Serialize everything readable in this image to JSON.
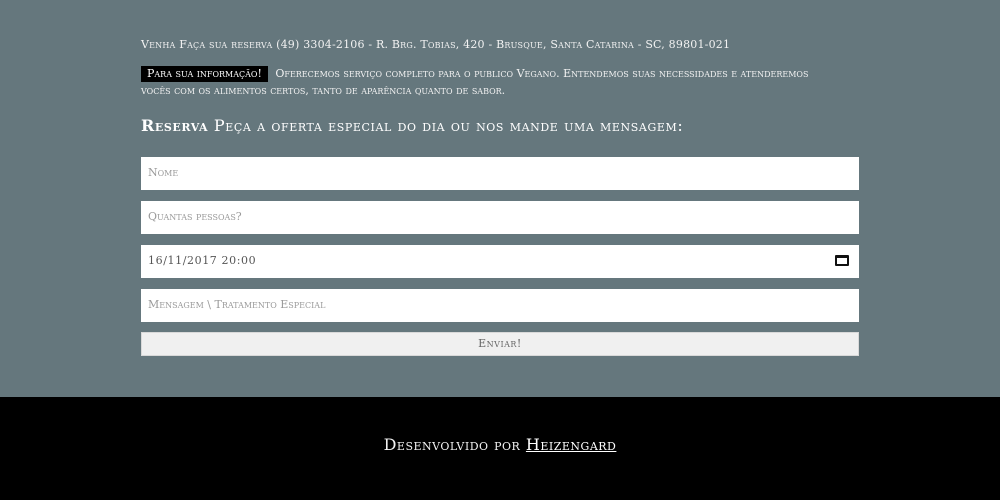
{
  "contact": {
    "text": "Venha Faça sua reserva (49) 3304-2106 - R. Brg. Tobias, 420 - Brusque, Santa Catarina - SC, 89801-021"
  },
  "info": {
    "tag": "Para sua informação!",
    "text": "Oferecemos serviço completo para o publico Vegano. Entendemos suas necessidades e atenderemos vocês com os alimentos certos, tanto de aparência quanto de sabor."
  },
  "reservation": {
    "heading_strong": "Reserva",
    "heading_rest": "Peça a oferta especial do dia ou nos mande uma mensagem:",
    "name_placeholder": "Nome",
    "people_placeholder": "Quantas pessoas?",
    "datetime_value": "16/11/2017 20:00",
    "message_placeholder": "Mensagem \\ Tratamento Especial",
    "submit_label": "Enviar!"
  },
  "footer": {
    "prefix": "Desenvolvido por",
    "link": "Heizengard"
  },
  "colors": {
    "main_background": "#65777d",
    "footer_background": "#000000"
  },
  "icons": {
    "datetime_picker": "calendar-icon"
  }
}
